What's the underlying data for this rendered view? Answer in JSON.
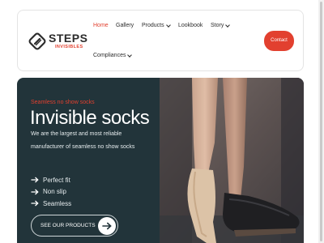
{
  "brand": {
    "name": "STEPS",
    "tagline": "INVISIBLES",
    "accent": "#e2402f",
    "dark": "#22343a"
  },
  "nav": {
    "home": "Home",
    "gallery": "Gallery",
    "products": "Products",
    "lookbook": "Lookbook",
    "story": "Story",
    "compliances": "Compliances",
    "contact": "Contact"
  },
  "hero": {
    "eyebrow": "Seamless no show socks",
    "title": "Invisible socks",
    "description": "We are the largest and most reliable manufacturer of seamless no show socks",
    "features": [
      "Perfect fit",
      "Non slip",
      "Seamless"
    ],
    "cta": "SEE OUR PRODUCTS",
    "icons": {
      "feature": "arrow-right-icon",
      "cta": "arrow-right-icon"
    }
  }
}
